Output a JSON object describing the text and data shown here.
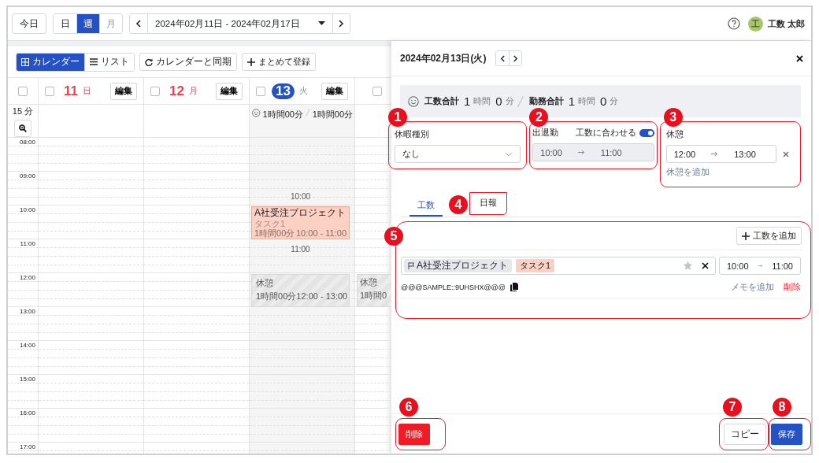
{
  "header": {
    "today_button": "今日",
    "views": [
      {
        "label": "日",
        "selected": false,
        "disabled": false
      },
      {
        "label": "週",
        "selected": true,
        "disabled": false
      },
      {
        "label": "月",
        "selected": false,
        "disabled": true
      }
    ],
    "date_range": "2024年02月11日 - 2024年02月17日",
    "user": {
      "initial": "工",
      "name": "工数 太郎"
    }
  },
  "calendar": {
    "modes": [
      {
        "label": "カレンダー",
        "selected": true,
        "kind": "grid"
      },
      {
        "label": "リスト",
        "selected": false,
        "kind": "list"
      }
    ],
    "sync_button": "カレンダーと同期",
    "bulk_button": "まとめて登録",
    "scale": "15 分",
    "select_all_checked": false,
    "days": [
      {
        "kind": "day",
        "checked": false,
        "date": "11",
        "weekday": "日",
        "holiday": true,
        "today": false,
        "edit": "編集"
      },
      {
        "kind": "day",
        "checked": false,
        "date": "12",
        "weekday": "月",
        "holiday": true,
        "today": false,
        "edit": "編集"
      },
      {
        "kind": "day",
        "checked": false,
        "date": "13",
        "weekday": "火",
        "holiday": false,
        "today": true,
        "edit": "編集",
        "totals": [
          "1時間00分",
          "1時間00分"
        ],
        "events": [
          {
            "kind": "work",
            "title": "A社受注プロジェクト",
            "task": "タスク1",
            "duration": "1時間00分",
            "time": "10:00 - 11:00",
            "marker_start": "10:00",
            "marker_end": "11:00"
          },
          {
            "kind": "break",
            "title": "休憩",
            "duration": "1時間00分",
            "time": "12:00 - 13:00"
          }
        ]
      },
      {
        "kind": "partial",
        "checked": false,
        "events": [
          {
            "kind": "break",
            "title": "休憩",
            "duration": "1時間0"
          }
        ]
      }
    ],
    "hours": [
      "08:00",
      "09:00",
      "10:00",
      "11:00",
      "12:00",
      "13:00",
      "14:00",
      "15:00",
      "16:00",
      "17:00"
    ]
  },
  "panel": {
    "title": "2024年02月13日(火)",
    "totals": [
      {
        "label": "工数合計",
        "hours": "1",
        "hour_unit": "時間",
        "minutes": "0",
        "minute_unit": "分"
      },
      {
        "label": "勤務合計",
        "hours": "1",
        "hour_unit": "時間",
        "minutes": "0",
        "minute_unit": "分"
      }
    ],
    "leave": {
      "badge": "1",
      "label": "休暇種別",
      "value": "なし"
    },
    "attendance": {
      "badge": "2",
      "label": "出退勤",
      "sync_label": "工数に合わせる",
      "sync_on": true,
      "start": "10:00",
      "end": "11:00"
    },
    "break": {
      "badge": "3",
      "label": "休憩",
      "start": "12:00",
      "end": "13:00",
      "add_link": "休憩を追加"
    },
    "tabs": [
      {
        "label": "工数",
        "selected": true
      },
      {
        "label": "日報",
        "selected": false,
        "badge": "4"
      }
    ],
    "entries": {
      "badge": "5",
      "add_button": "工数を追加",
      "items": [
        {
          "project": "A社受注プロジェクト",
          "task": "タスク1",
          "starred": false,
          "start": "10:00",
          "end": "11:00",
          "code": "@@@SAMPLE::9UHSHX@@@",
          "memo_link": "メモを追加",
          "delete_link": "削除"
        }
      ]
    },
    "footer": {
      "delete": {
        "label": "削除",
        "badge": "6"
      },
      "copy": {
        "label": "コピー",
        "badge": "7"
      },
      "save": {
        "label": "保存",
        "badge": "8"
      }
    }
  }
}
